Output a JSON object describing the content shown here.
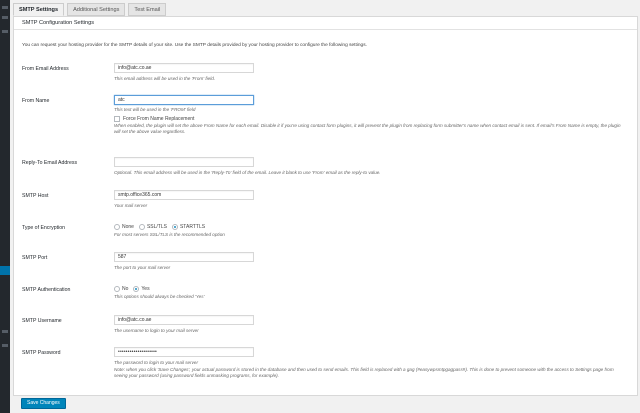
{
  "tabs": [
    {
      "label": "SMTP Settings"
    },
    {
      "label": "Additional Settings"
    },
    {
      "label": "Test Email"
    }
  ],
  "panel": {
    "title": "SMTP Configuration Settings",
    "intro": "You can request your hosting provider for the SMTP details of your site. Use the SMTP details provided by your hosting provider to configure the following settings."
  },
  "fields": {
    "from_email": {
      "label": "From Email Address",
      "value": "info@atc.co.ae",
      "desc": "This email address will be used in the 'From' field."
    },
    "from_name": {
      "label": "From Name",
      "value": "atc",
      "desc": "This text will be used in the 'FROM' field",
      "force_label": "Force From Name Replacement",
      "force_desc": "When enabled, the plugin will set the above From Name for each email. Disable it if you're using contact form plugins, it will prevent the plugin from replacing form submitter's name when contact email is sent. If email's From Name is empty, the plugin will set the above value regardless."
    },
    "reply_to": {
      "label": "Reply-To Email Address",
      "value": "",
      "desc": "Optional. This email address will be used in the 'Reply-To' field of the email. Leave it blank to use 'From' email as the reply-to value."
    },
    "smtp_host": {
      "label": "SMTP Host",
      "value": "smtp.office365.com",
      "desc": "Your mail server"
    },
    "encryption": {
      "label": "Type of Encryption",
      "options": [
        "None",
        "SSL/TLS",
        "STARTTLS"
      ],
      "selected": "STARTTLS",
      "desc": "For most servers SSL/TLS is the recommended option"
    },
    "smtp_port": {
      "label": "SMTP Port",
      "value": "587",
      "desc": "The port to your mail server"
    },
    "smtp_auth": {
      "label": "SMTP Authentication",
      "options": [
        "No",
        "Yes"
      ],
      "selected": "Yes",
      "desc": "This options should always be checked 'Yes'"
    },
    "smtp_user": {
      "label": "SMTP Username",
      "value": "info@atc.co.ae",
      "desc": "The username to login to your mail server"
    },
    "smtp_pass": {
      "label": "SMTP Password",
      "value": "••••••••••••••••••••",
      "desc": "The password to login to your mail server",
      "note": "Note: when you click 'Save Changes', your actual password is stored in the database and then used to send emails. This field is replaced with a gag (#easywpsmtpgagpass#). This is done to prevent someone with the access to Settings page from seeing your password (using password fields unmasking programs, for example)."
    }
  },
  "save_label": "Save Changes"
}
